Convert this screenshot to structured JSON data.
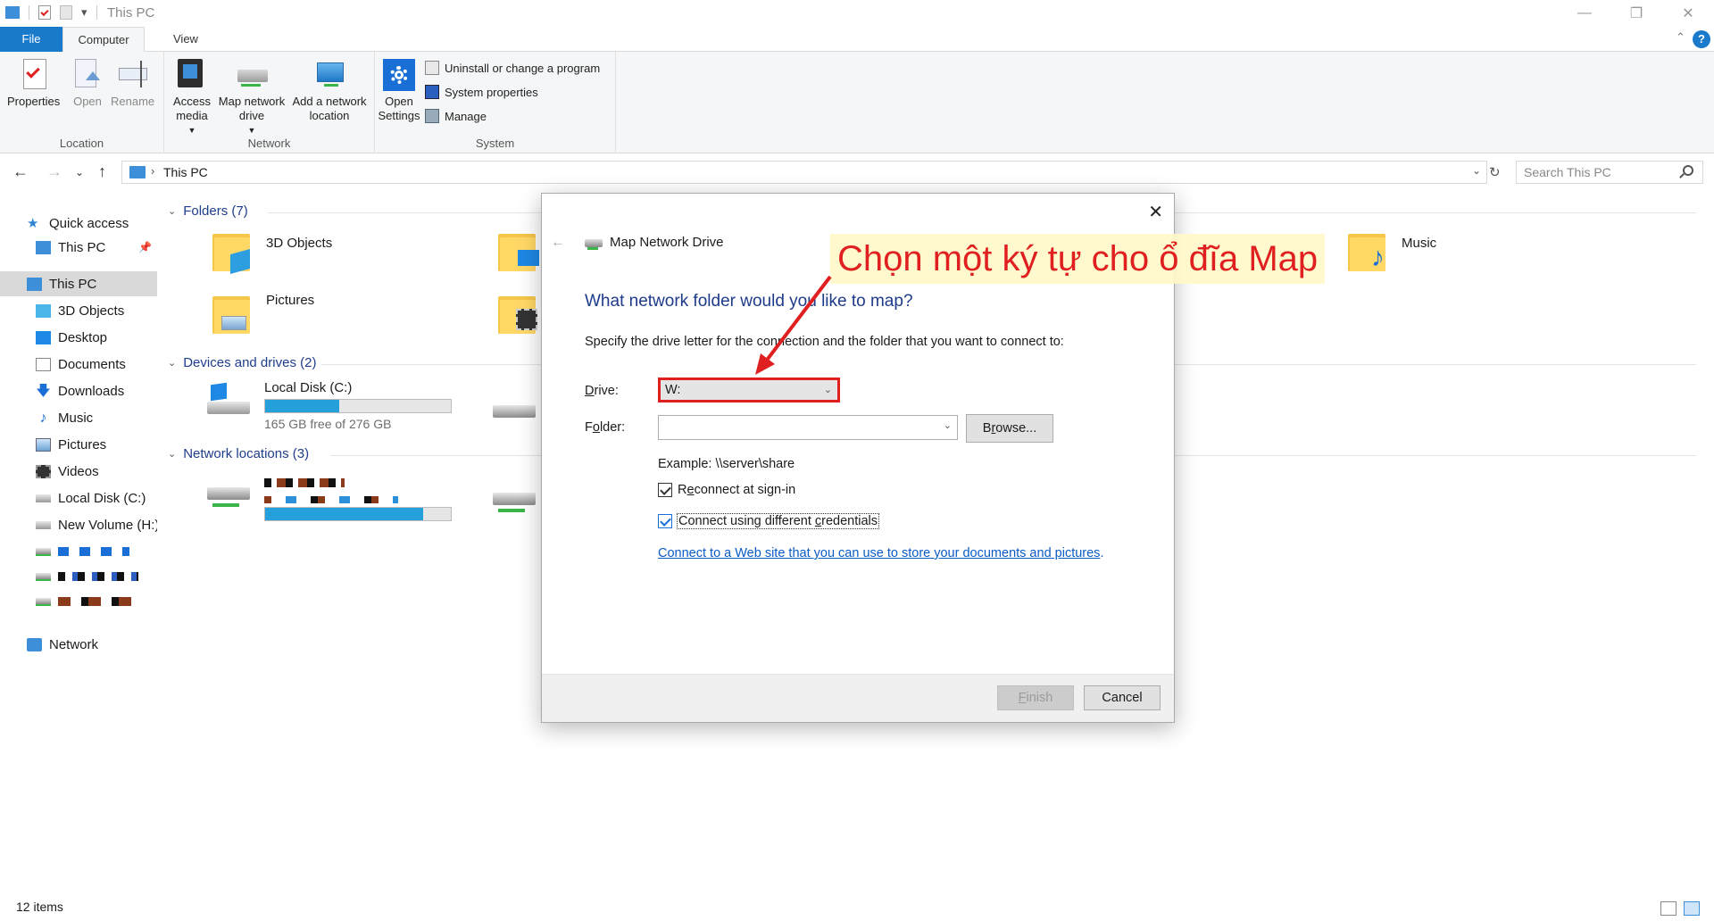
{
  "window": {
    "title": "This PC",
    "qat_dropdown_glyph": "▾"
  },
  "ribbon": {
    "tabs": [
      "File",
      "Computer",
      "View"
    ],
    "active_tab": "Computer",
    "groups": {
      "location": {
        "label": "Location",
        "buttons": [
          "Properties",
          "Open",
          "Rename"
        ]
      },
      "network": {
        "label": "Network",
        "access_media": "Access media",
        "map_network_drive": "Map network drive",
        "add_network_location": "Add a network location"
      },
      "system": {
        "label": "System",
        "open_settings": "Open Settings",
        "uninstall": "Uninstall or change a program",
        "system_properties": "System properties",
        "manage": "Manage"
      }
    }
  },
  "address": {
    "path": "This PC",
    "search_placeholder": "Search This PC"
  },
  "nav": {
    "quick_access": "Quick access",
    "this_pc_pinned": "This PC",
    "this_pc": "This PC",
    "items": [
      "3D Objects",
      "Desktop",
      "Documents",
      "Downloads",
      "Music",
      "Pictures",
      "Videos",
      "Local Disk (C:)",
      "New Volume (H:)"
    ],
    "network": "Network"
  },
  "content": {
    "folders_header": "Folders (7)",
    "folders": [
      "3D Objects",
      "Pictures",
      "Music"
    ],
    "devices_header": "Devices and drives (2)",
    "local_disk": {
      "name": "Local Disk (C:)",
      "free_text": "165 GB free of 276 GB",
      "used_fraction": 0.4
    },
    "network_header": "Network locations (3)",
    "network_drive": {
      "used_fraction": 0.85
    }
  },
  "dialog": {
    "title": "Map Network Drive",
    "heading": "What network folder would you like to map?",
    "instruction": "Specify the drive letter for the connection and the folder that you want to connect to:",
    "drive_label_pre": "D",
    "drive_label_post": "rive:",
    "drive_value": "W:",
    "folder_label_pre": "F",
    "folder_label_mid": "o",
    "folder_label_post": "lder:",
    "folder_value": "",
    "browse_pre": "B",
    "browse_mid": "r",
    "browse_post": "owse...",
    "example": "Example: \\\\server\\share",
    "reconnect_pre": "R",
    "reconnect_mid": "e",
    "reconnect_post": "connect at sign-in",
    "reconnect_checked": true,
    "credentials_pre": "Connect using different ",
    "credentials_mid": "c",
    "credentials_post": "redentials",
    "credentials_checked": true,
    "link": "Connect to a Web site that you can use to store your documents and pictures",
    "link_suffix": ".",
    "finish_pre": "",
    "finish_mid": "F",
    "finish_post": "inish",
    "cancel": "Cancel"
  },
  "annotation": {
    "text": "Chọn một ký tự cho ổ đĩa Map",
    "color": "#e02020"
  },
  "status": {
    "count": "12 items"
  },
  "colors": {
    "accent": "#1979ca",
    "link": "#0a5bc4",
    "heading": "#1e3a8a",
    "drive_bar": "#26a0da"
  }
}
